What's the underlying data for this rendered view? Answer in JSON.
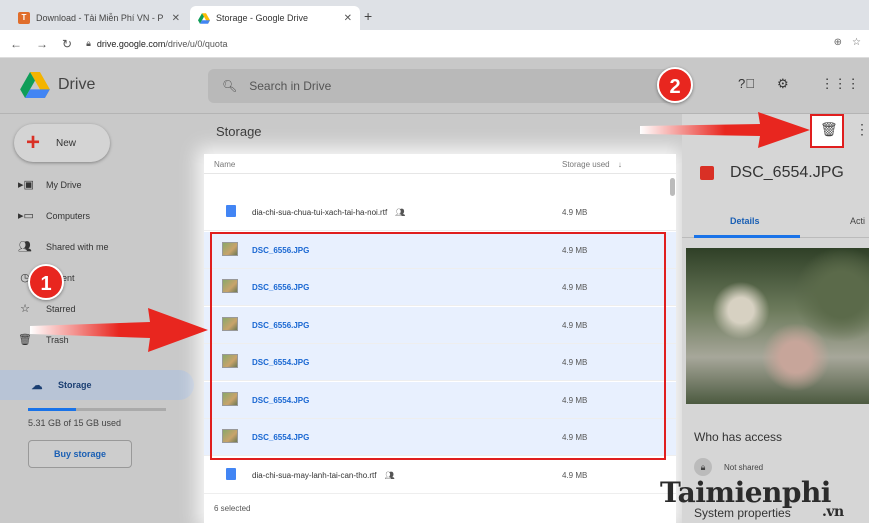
{
  "browser": {
    "tabs": [
      {
        "title": "Download - Tải Miễn Phí VN - P",
        "icon": "T"
      },
      {
        "title": "Storage - Google Drive",
        "icon": "drive"
      }
    ],
    "url_domain": "drive.google.com",
    "url_path": "/drive/u/0/quota"
  },
  "header": {
    "app_name": "Drive",
    "search_placeholder": "Search in Drive"
  },
  "sidebar": {
    "new_label": "New",
    "items": [
      {
        "label": "My Drive"
      },
      {
        "label": "Computers"
      },
      {
        "label": "Shared with me"
      },
      {
        "label": "Recent"
      },
      {
        "label": "Starred"
      },
      {
        "label": "Trash"
      },
      {
        "label": "Storage"
      }
    ],
    "quota_text": "5.31 GB of 15 GB used",
    "quota_fraction": 0.35,
    "buy_label": "Buy storage"
  },
  "main": {
    "title": "Storage",
    "columns": {
      "name": "Name",
      "storage": "Storage used"
    },
    "rows": [
      {
        "name": "dia-chi-sua-chua-tui-xach-tai-ha-noi.rtf",
        "size": "4.9 MB",
        "type": "doc",
        "selected": false
      },
      {
        "name": "DSC_6556.JPG",
        "size": "4.9 MB",
        "type": "image",
        "selected": true
      },
      {
        "name": "DSC_6556.JPG",
        "size": "4.9 MB",
        "type": "image",
        "selected": true
      },
      {
        "name": "DSC_6556.JPG",
        "size": "4.9 MB",
        "type": "image",
        "selected": true
      },
      {
        "name": "DSC_6554.JPG",
        "size": "4.9 MB",
        "type": "image",
        "selected": true
      },
      {
        "name": "DSC_6554.JPG",
        "size": "4.9 MB",
        "type": "image",
        "selected": true
      },
      {
        "name": "DSC_6554.JPG",
        "size": "4.9 MB",
        "type": "image",
        "selected": true
      },
      {
        "name": "dia-chi-sua-may-lanh-tai-can-tho.rtf",
        "size": "4.9 MB",
        "type": "doc",
        "selected": false
      }
    ],
    "selection_text": "6 selected"
  },
  "details": {
    "title": "DSC_6554.JPG",
    "tab_details": "Details",
    "tab_activity": "Acti",
    "access_title": "Who has access",
    "not_shared": "Not shared",
    "system_props": "System properties"
  },
  "annotations": {
    "badge1": "1",
    "badge2": "2"
  },
  "watermark": {
    "text": "Taimienphi",
    "suffix": ".vn"
  },
  "colors": {
    "accent": "#1a73e8",
    "annotation_red": "#e8261f"
  }
}
